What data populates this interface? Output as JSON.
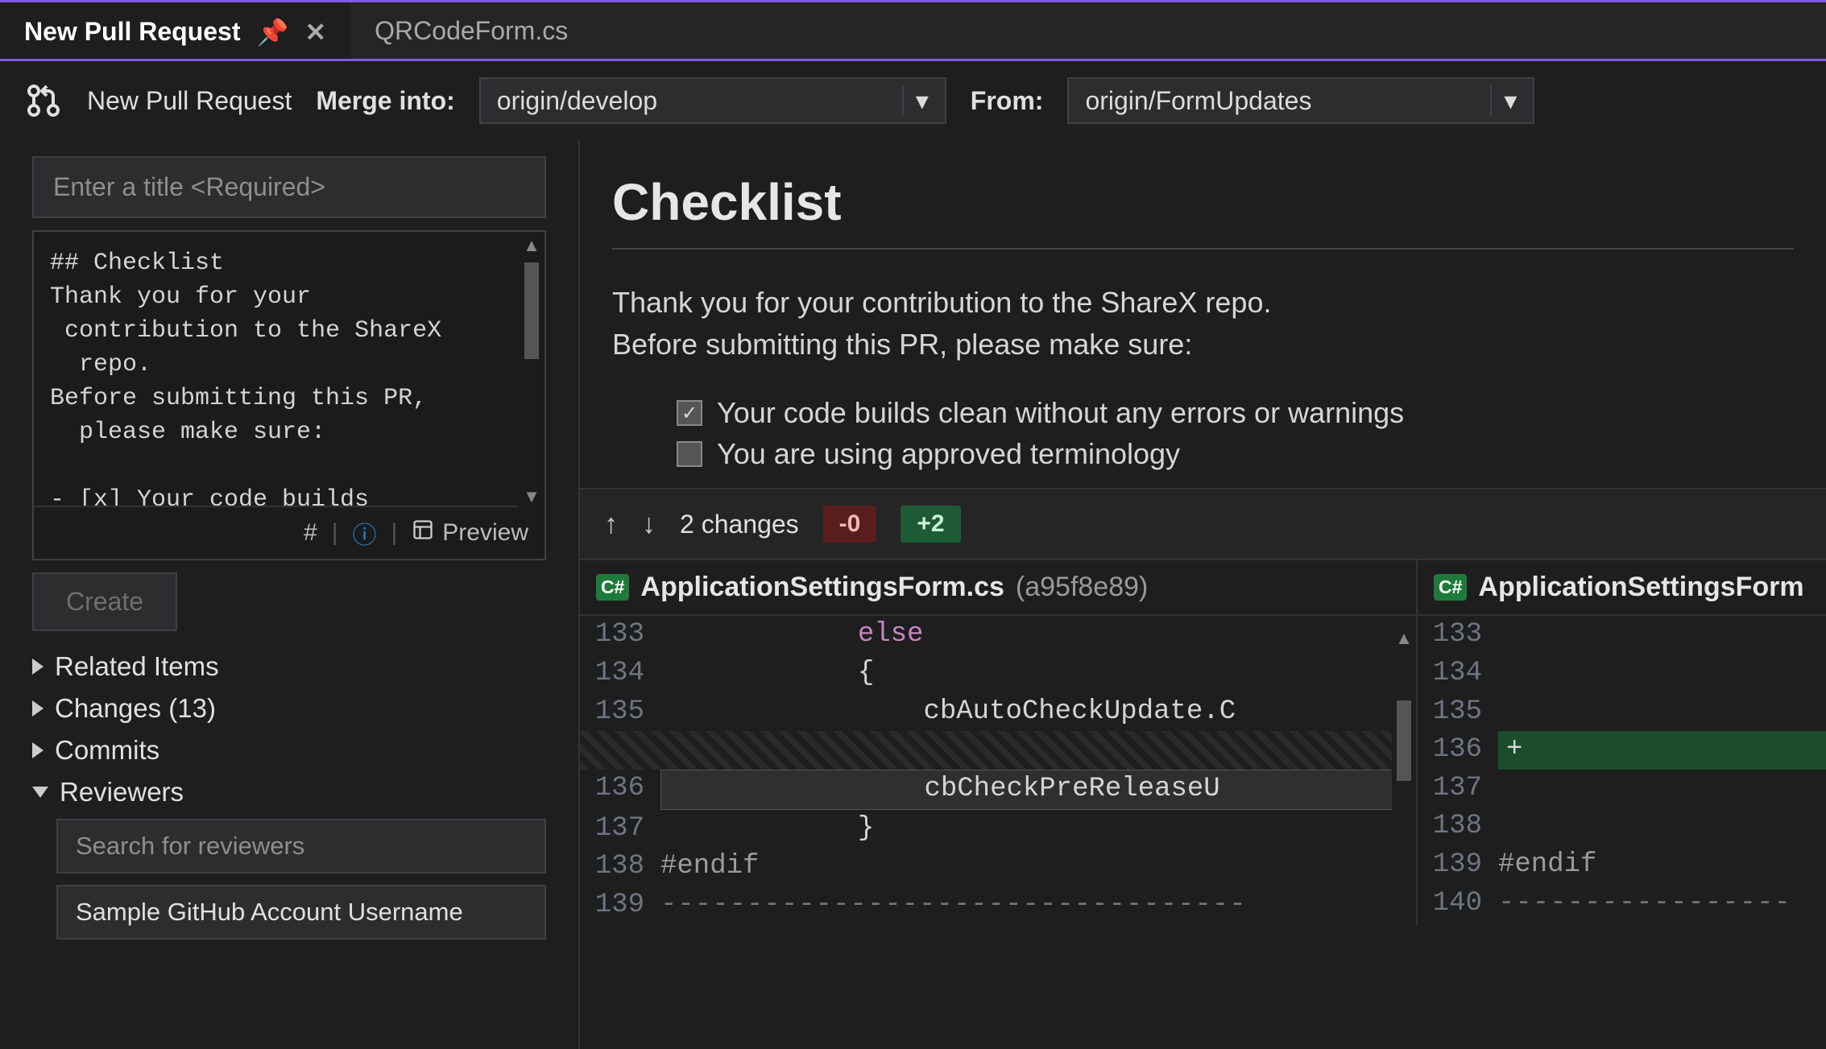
{
  "tabs": {
    "active": "New Pull Request",
    "inactive": "QRCodeForm.cs"
  },
  "header": {
    "title": "New Pull Request",
    "mergeIntoLabel": "Merge into:",
    "mergeIntoValue": "origin/develop",
    "fromLabel": "From:",
    "fromValue": "origin/FormUpdates"
  },
  "titleInput": {
    "placeholder": "Enter a title <Required>"
  },
  "description": {
    "text": "## Checklist\nThank you for your\n contribution to the ShareX\n  repo.\nBefore submitting this PR,\n  please make sure:\n\n- [x] Your code builds",
    "previewLabel": "Preview"
  },
  "createButton": "Create",
  "tree": {
    "relatedItems": "Related Items",
    "changes": "Changes (13)",
    "commits": "Commits",
    "reviewers": "Reviewers",
    "reviewerSearchPlaceholder": "Search for reviewers",
    "reviewerSample": "Sample GitHub Account Username"
  },
  "preview": {
    "heading": "Checklist",
    "para1": "Thank you for your contribution to the ShareX repo.",
    "para2": "Before submitting this PR, please make sure:",
    "check1": "Your code builds clean without any errors or warnings",
    "check2": "You are using approved terminology"
  },
  "diffBar": {
    "changes": "2 changes",
    "minus": "-0",
    "plus": "+2"
  },
  "fileLeft": {
    "name": "ApplicationSettingsForm.cs",
    "sha": "(a95f8e89)"
  },
  "fileRight": {
    "name": "ApplicationSettingsForm"
  },
  "codeLeft": [
    {
      "n": "133",
      "txt": "            else",
      "kw": true
    },
    {
      "n": "134",
      "txt": "            {"
    },
    {
      "n": "135",
      "txt": "                cbAutoCheckUpdate.C"
    },
    {
      "n": "",
      "hatched": true
    },
    {
      "n": "136",
      "txt": "                cbCheckPreReleaseU",
      "sel": true
    },
    {
      "n": "137",
      "txt": "            }"
    },
    {
      "n": "138",
      "txt": "#endif",
      "pp": true
    },
    {
      "n": "139",
      "txt": "----------------------------------",
      "dash": true
    }
  ],
  "codeRight": [
    {
      "n": "133",
      "txt": ""
    },
    {
      "n": "134",
      "txt": ""
    },
    {
      "n": "135",
      "txt": ""
    },
    {
      "n": "136",
      "txt": "",
      "added": true,
      "plus": true
    },
    {
      "n": "137",
      "txt": ""
    },
    {
      "n": "138",
      "txt": ""
    },
    {
      "n": "139",
      "txt": "#endif",
      "pp": true
    },
    {
      "n": "140",
      "txt": "-----------------",
      "dash": true
    }
  ]
}
